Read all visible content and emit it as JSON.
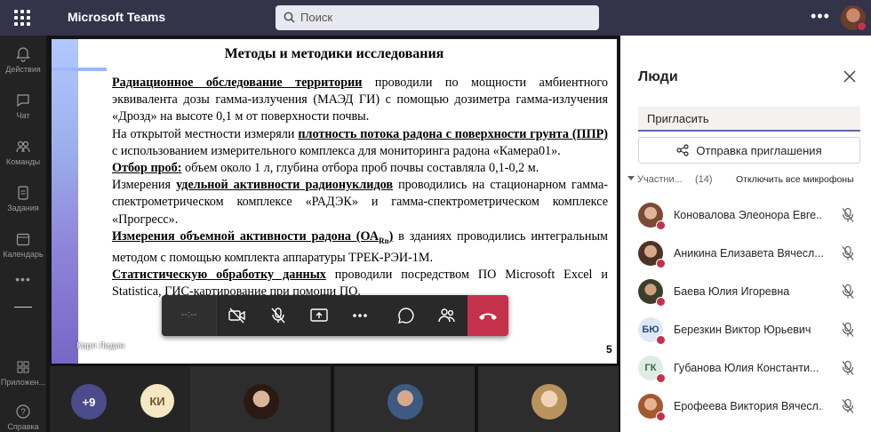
{
  "topbar": {
    "app_title": "Microsoft Teams",
    "search_placeholder": "Поиск",
    "accent_color": "#33344a"
  },
  "rail": {
    "items": [
      {
        "label": "Действия",
        "icon": "bell-icon"
      },
      {
        "label": "Чат",
        "icon": "chat-icon"
      },
      {
        "label": "Команды",
        "icon": "teams-icon"
      },
      {
        "label": "Задания",
        "icon": "assignments-icon"
      },
      {
        "label": "Календарь",
        "icon": "calendar-icon"
      },
      {
        "label": "Приложен...",
        "icon": "apps-icon"
      },
      {
        "label": "Справка",
        "icon": "help-icon"
      }
    ]
  },
  "slide": {
    "title": "Методы и методики исследования",
    "paragraphs": [
      {
        "bold": "Радиационное обследование территории",
        "text": " проводили по мощности амбиентного эквивалента дозы гамма-излучения (МАЭД ГИ) с помощью дозиметра гамма-излучения «Дрозд» на высоте 0,1 м от поверхности почвы."
      },
      {
        "prefix": "На открытой местности измеряли ",
        "bold": "плотность потока радона с поверхности грунта (ППР)",
        "text": " с использованием измерительного комплекса для мониторинга радона «Камера01»."
      },
      {
        "bold": "Отбор проб:",
        "text": " объем около 1 л, глубина отбора проб почвы составляла 0,1-0,2 м."
      },
      {
        "prefix": "Измерения ",
        "bold": "удельной активности радионуклидов",
        "text": " проводились на стационарном гамма-спектрометрическом комплексе «РАДЭК» и гамма-спектрометрическом комплексе «Прогресс»."
      },
      {
        "bold": "Измерения объемной активности радона (ОА",
        "sub": "Rn",
        "bold2": ")",
        "text": " в зданиях проводились интегральным методом с помощью комплекта аппаратуры ТРЕК-РЭИ-1М."
      },
      {
        "bold": "Статистическую обработку данных",
        "text": " проводили посредством ПО Microsoft Excel и Statistica, ГИС-картирование при помощи ПО."
      }
    ],
    "presenter_name": "Карл Лидин",
    "page_number": "5"
  },
  "controls": {
    "timer": "--:--",
    "hangup_color": "#c4314b"
  },
  "strip": {
    "overflow_count": "+9",
    "ki_initials": "КИ"
  },
  "people_panel": {
    "title": "Люди",
    "invite_placeholder": "Пригласить",
    "share_invite_label": "Отправка приглашения",
    "participants_label": "Участни...",
    "participants_count": "(14)",
    "mute_all_label": "Отключить все микрофоны",
    "participants": [
      {
        "name": "Коновалова Элеонора Евге...",
        "avatar": "photo",
        "initials": ""
      },
      {
        "name": "Аникина Елизавета Вячесл...",
        "avatar": "photo",
        "initials": ""
      },
      {
        "name": "Баева Юлия Игоревна",
        "avatar": "photo",
        "initials": ""
      },
      {
        "name": "Березкин Виктор Юрьевич",
        "avatar": "initials",
        "initials": "БЮ"
      },
      {
        "name": "Губанова Юлия Константи...",
        "avatar": "initials",
        "initials": "ГК"
      },
      {
        "name": "Ерофеева Виктория Вячесл...",
        "avatar": "photo",
        "initials": ""
      }
    ]
  }
}
